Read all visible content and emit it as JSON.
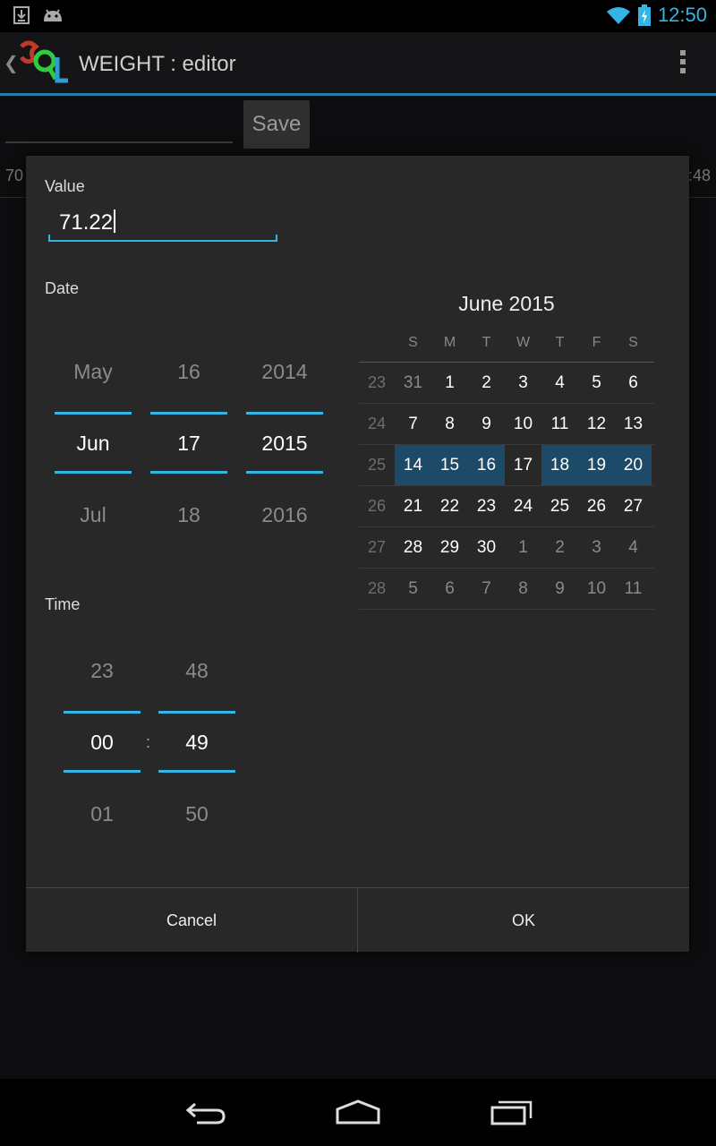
{
  "status_bar": {
    "time": "12:50"
  },
  "action_bar": {
    "title": "WEIGHT : editor"
  },
  "background": {
    "save_label": "Save",
    "row_left": "70",
    "row_right": ":48"
  },
  "dialog": {
    "value_label": "Value",
    "value": "71.22",
    "date_label": "Date",
    "date_picker": {
      "month": {
        "prev": "May",
        "current": "Jun",
        "next": "Jul"
      },
      "day": {
        "prev": "16",
        "current": "17",
        "next": "18"
      },
      "year": {
        "prev": "2014",
        "current": "2015",
        "next": "2016"
      }
    },
    "time_label": "Time",
    "time_picker": {
      "hour": {
        "prev": "23",
        "current": "00",
        "next": "01"
      },
      "minute": {
        "prev": "48",
        "current": "49",
        "next": "50"
      },
      "separator": ":"
    },
    "calendar": {
      "title": "June 2015",
      "weekdays": [
        "S",
        "M",
        "T",
        "W",
        "T",
        "F",
        "S"
      ],
      "weeks": [
        {
          "wk": "23",
          "days": [
            "31",
            "1",
            "2",
            "3",
            "4",
            "5",
            "6"
          ]
        },
        {
          "wk": "24",
          "days": [
            "7",
            "8",
            "9",
            "10",
            "11",
            "12",
            "13"
          ]
        },
        {
          "wk": "25",
          "days": [
            "14",
            "15",
            "16",
            "17",
            "18",
            "19",
            "20"
          ]
        },
        {
          "wk": "26",
          "days": [
            "21",
            "22",
            "23",
            "24",
            "25",
            "26",
            "27"
          ]
        },
        {
          "wk": "27",
          "days": [
            "28",
            "29",
            "30",
            "1",
            "2",
            "3",
            "4"
          ]
        },
        {
          "wk": "28",
          "days": [
            "5",
            "6",
            "7",
            "8",
            "9",
            "10",
            "11"
          ]
        }
      ]
    },
    "cancel_label": "Cancel",
    "ok_label": "OK"
  }
}
